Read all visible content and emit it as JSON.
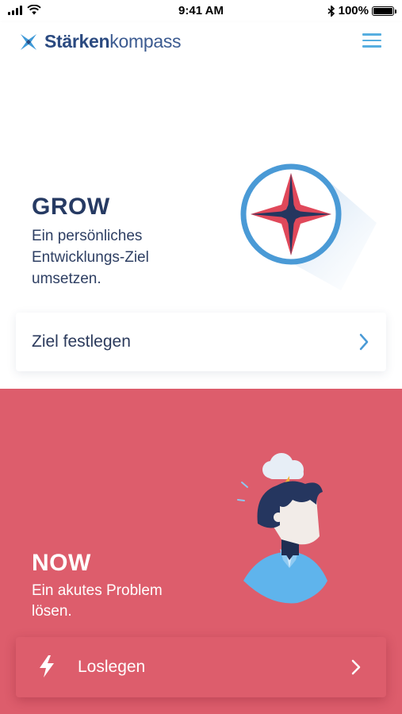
{
  "status_bar": {
    "time": "9:41 AM",
    "battery_text": "100%",
    "battery_level": 1.0,
    "icons": [
      "signal-icon",
      "wifi-icon",
      "bluetooth-icon",
      "battery-icon"
    ]
  },
  "header": {
    "brand_strong": "Stärken",
    "brand_light": "kompass",
    "logo_icon": "compass-star-icon",
    "menu_icon": "hamburger-menu-icon"
  },
  "grow": {
    "title": "GROW",
    "description": "Ein persönliches Entwicklungs-Ziel umsetzen.",
    "illustration": "compass-icon",
    "action_label": "Ziel festlegen",
    "action_icon": "chevron-right-icon"
  },
  "now": {
    "title": "NOW",
    "description": "Ein akutes Problem lösen.",
    "illustration": "stressed-person-storm-cloud",
    "action_label": "Loslegen",
    "action_icon": "lightning-icon",
    "action_chevron": "chevron-right-icon"
  },
  "colors": {
    "brand_blue": "#2b4a80",
    "accent_blue": "#56aee0",
    "now_red": "#dd5d6c",
    "compass_red": "#e0485a",
    "navy": "#263a63"
  }
}
